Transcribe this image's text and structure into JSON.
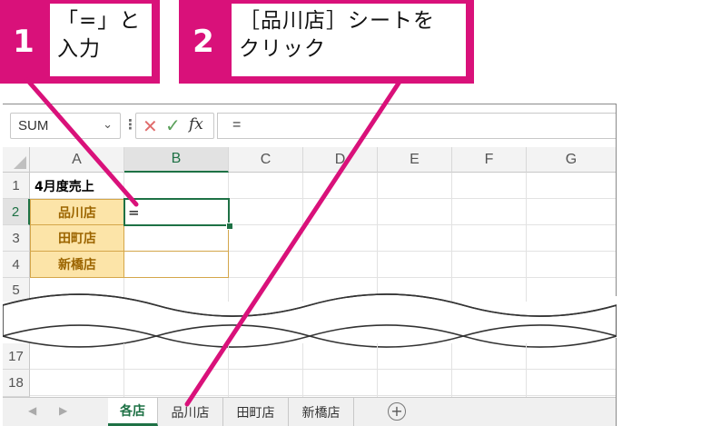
{
  "callouts": [
    {
      "number": "1",
      "text": "「=」と\n入力"
    },
    {
      "number": "2",
      "text": "［品川店］シートを\nクリック"
    }
  ],
  "formula_bar": {
    "name_box": "SUM",
    "chevron_icon": "chevron-down-icon",
    "more_icon": "vertical-ellipsis-icon",
    "cancel_icon": "close-icon",
    "enter_icon": "check-icon",
    "fx_label": "fx",
    "formula": "="
  },
  "columns": [
    "A",
    "B",
    "C",
    "D",
    "E",
    "F",
    "G"
  ],
  "rows_top": [
    "1",
    "2",
    "3",
    "4",
    "5"
  ],
  "rows_bottom": [
    "17",
    "18"
  ],
  "cells": {
    "a1": "4月度売上",
    "a2": "品川店",
    "a3": "田町店",
    "a4": "新橋店",
    "b2": "="
  },
  "sheet_tabs": [
    "各店",
    "品川店",
    "田町店",
    "新橋店"
  ],
  "active_tab": "各店",
  "add_sheet_icon": "plus-circle-icon",
  "colors": {
    "accent_pink": "#d9117a",
    "excel_green": "#1e7145",
    "store_fill": "#fce4a8",
    "store_border": "#d4a64a"
  }
}
